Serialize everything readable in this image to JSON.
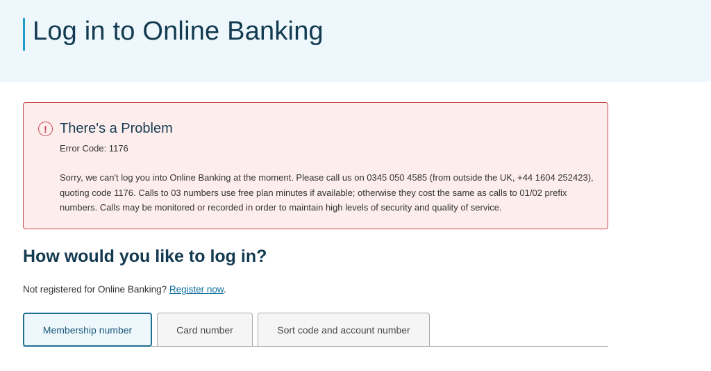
{
  "header": {
    "title": "Log in to Online Banking"
  },
  "error": {
    "icon": "alert-circle-icon",
    "icon_glyph": "!",
    "title": "There's a Problem",
    "code_text": "Error Code: 1176",
    "message": "Sorry, we can't log you into Online Banking at the moment. Please call us on 0345 050 4585 (from outside the UK, +44 1604 252423), quoting code 1176. Calls to 03 numbers use free plan minutes if available; otherwise they cost the same as calls to 01/02 prefix numbers. Calls may be monitored or recorded in order to maintain high levels of security and quality of service."
  },
  "login": {
    "heading": "How would you like to log in?",
    "register_prompt": "Not registered for Online Banking? ",
    "register_link": "Register now",
    "register_suffix": ".",
    "tabs": [
      {
        "label": "Membership number",
        "active": true
      },
      {
        "label": "Card number",
        "active": false
      },
      {
        "label": "Sort code and account number",
        "active": false
      }
    ]
  },
  "colors": {
    "accent": "#1a9bd1",
    "header_bg": "#eef7fb",
    "error_border": "#c9464c",
    "error_bg": "#fdeded",
    "link": "#0e6e9e",
    "active_tab_border": "#1f6f94"
  }
}
